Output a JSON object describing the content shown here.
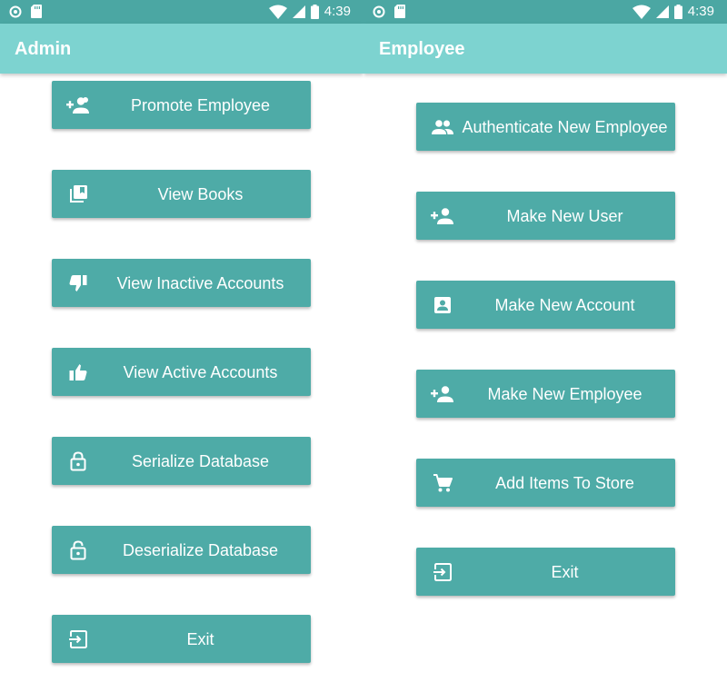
{
  "admin": {
    "status_time": "4:39",
    "title": "Admin",
    "buttons": [
      {
        "label": "Promote Employee",
        "icon": "person-add-alt-icon"
      },
      {
        "label": "View Books",
        "icon": "library-books-icon"
      },
      {
        "label": "View Inactive Accounts",
        "icon": "thumb-down-icon"
      },
      {
        "label": "View Active Accounts",
        "icon": "thumb-up-icon"
      },
      {
        "label": "Serialize Database",
        "icon": "lock-icon"
      },
      {
        "label": "Deserialize Database",
        "icon": "lock-open-icon"
      },
      {
        "label": "Exit",
        "icon": "exit-icon"
      }
    ]
  },
  "employee": {
    "status_time": "4:39",
    "title": "Employee",
    "buttons": [
      {
        "label": "Authenticate New Employee",
        "icon": "people-icon"
      },
      {
        "label": "Make New User",
        "icon": "person-add-icon"
      },
      {
        "label": "Make New Account",
        "icon": "account-box-icon"
      },
      {
        "label": "Make New Employee",
        "icon": "person-add-icon"
      },
      {
        "label": "Add Items To Store",
        "icon": "cart-icon"
      },
      {
        "label": "Exit",
        "icon": "exit-icon"
      }
    ]
  },
  "colors": {
    "status_bar": "#4ba7a3",
    "app_bar": "#7dd3d0",
    "button": "#4eaba7",
    "text": "#ffffff"
  }
}
